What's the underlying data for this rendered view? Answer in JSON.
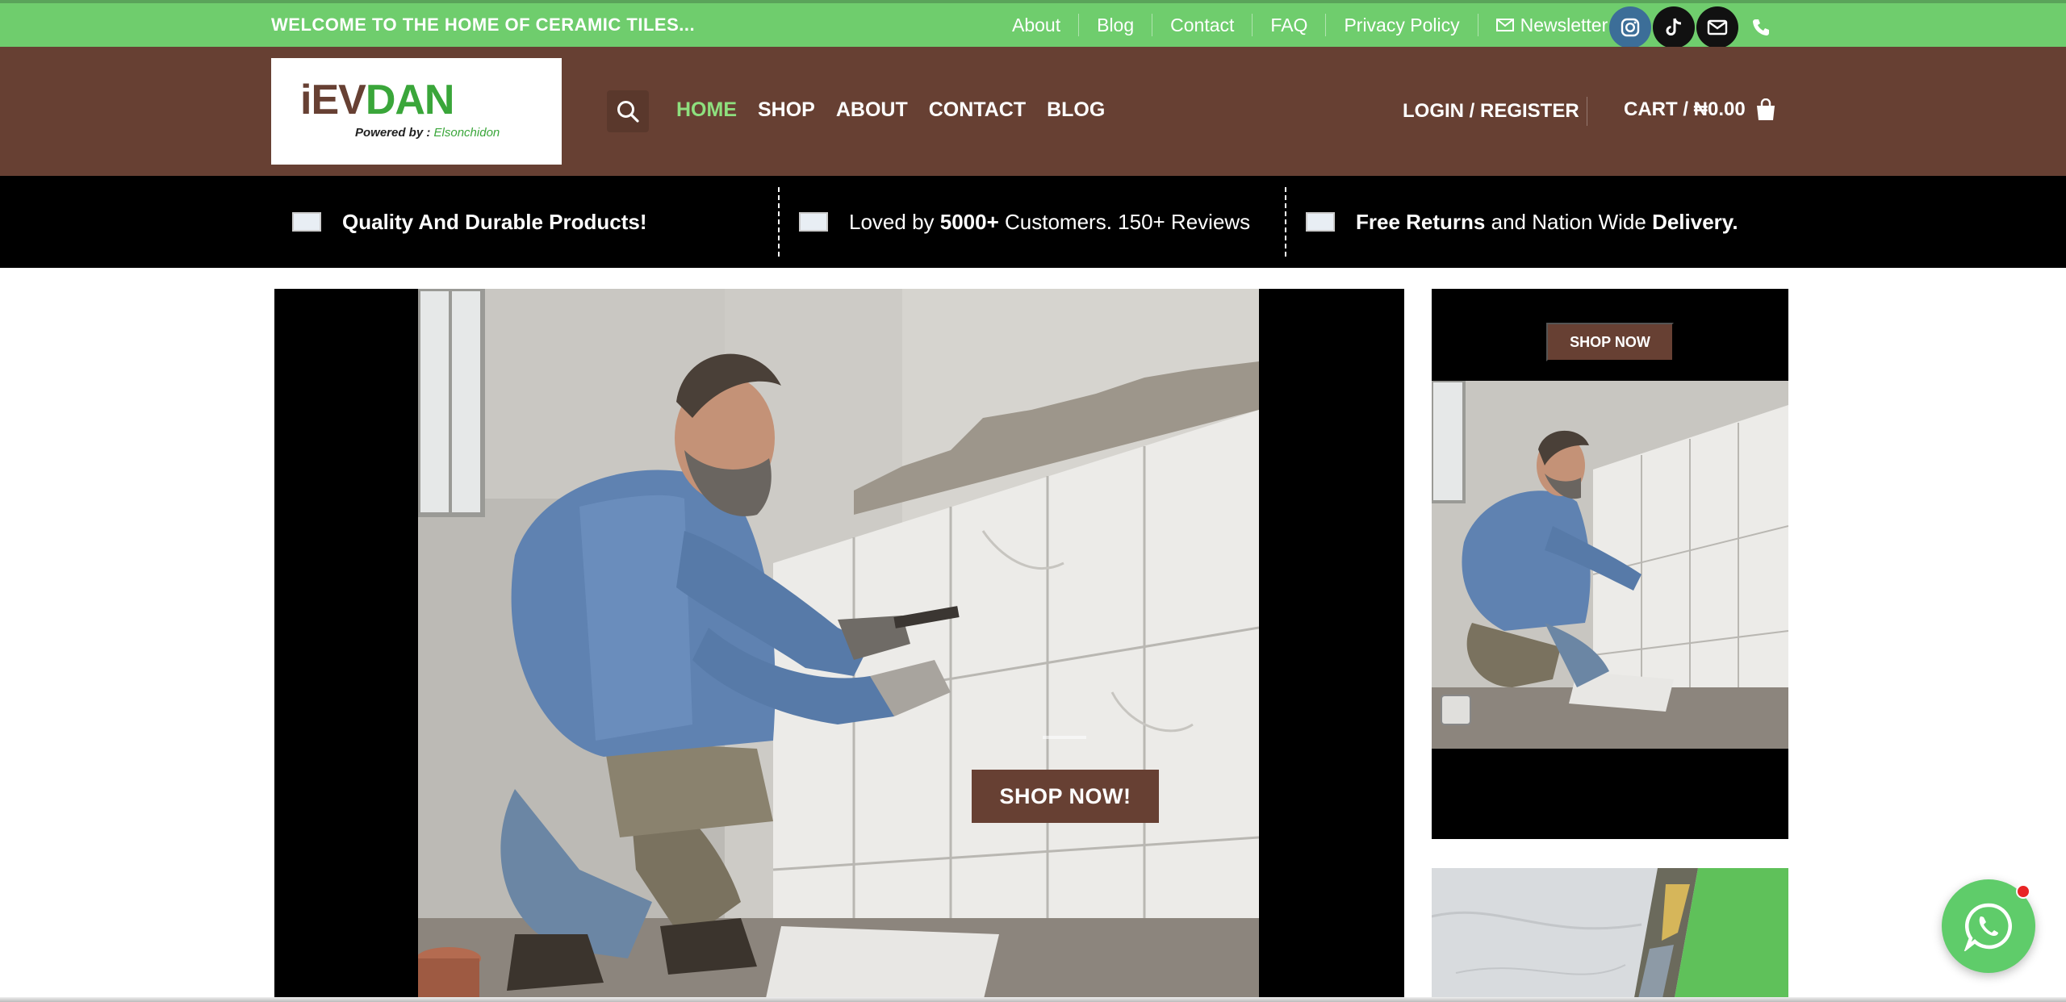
{
  "topbar": {
    "welcome": "WELCOME TO THE HOME OF CERAMIC TILES...",
    "links": [
      "About",
      "Blog",
      "Contact",
      "FAQ",
      "Privacy Policy"
    ],
    "newsletter": "Newsletter",
    "bg_color": "#6fcd6d"
  },
  "socials": [
    "instagram-icon",
    "tiktok-icon",
    "mail-icon",
    "phone-icon"
  ],
  "header": {
    "logo_i": "i",
    "logo_e": "EV",
    "logo_dan": "DAN",
    "logo_powered": "Powered by : ",
    "logo_powered_name": "Elsonchidon",
    "nav": [
      "HOME",
      "SHOP",
      "ABOUT",
      "CONTACT",
      "BLOG"
    ],
    "active_nav": "HOME",
    "login": "LOGIN / REGISTER",
    "cart": "CART / ₦0.00",
    "bg_color": "#674033"
  },
  "promo": {
    "col1": {
      "bold": "Quality And Durable Products!"
    },
    "col2": {
      "pre": "Loved by ",
      "bold": "5000+",
      "post": " Customers.  150+ Reviews"
    },
    "col3": {
      "bold1": "Free Returns",
      "mid": " and Nation Wide ",
      "bold2": "Delivery."
    }
  },
  "hero": {
    "button": "SHOP NOW!"
  },
  "side_card": {
    "button": "SHOP NOW"
  },
  "whatsapp": {
    "icon": "whatsapp-icon",
    "badge_color": "#e82525"
  }
}
